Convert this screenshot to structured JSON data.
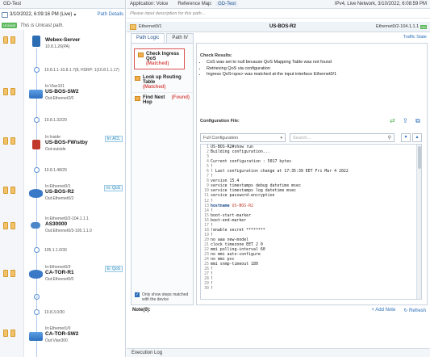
{
  "left_panel": {
    "title": "GD-Test",
    "datetime": "3/10/2022, 6:09:16 PM (Live)",
    "path_details": "Path Details",
    "unicast_badge": "Unicast",
    "unicast_note": "This is Unicast path.",
    "nodes": [
      {
        "top": "Webex-Server",
        "sub": "10.8.1.26(PA)",
        "icon": "server-icon",
        "tag": ""
      },
      {
        "top": "In:Vlan101",
        "name": "US-BOS-SW2",
        "out": "Out:Ethernet2/0",
        "icon": "switch-icon",
        "tag": ""
      },
      {
        "top": "In:Inside",
        "name": "US-BOS-FW\\stby",
        "out": "Out:outside",
        "icon": "firewall-icon",
        "tag": "In: ACL"
      },
      {
        "top": "In:Ethernet0/1",
        "name": "US-BOS-R2",
        "out": "Out:Ethernet0/2",
        "icon": "router-icon",
        "tag": "In: QoS"
      },
      {
        "top": "In:Ethernet0/2-104.1.1.1",
        "name": "AS30000",
        "out": "Out:Ethernet0/3-105.1.1.0",
        "icon": "cloud-icon",
        "tag": ""
      },
      {
        "top": "In:Ethernet0/3",
        "name": "CA-TOR-R1",
        "out": "Out:Ethernet0/0",
        "icon": "router-icon",
        "tag": "E: QoS"
      },
      {
        "top": "In:Ethernet1/0",
        "name": "CA-TOR-SW2",
        "out": "Out:Vlan300",
        "icon": "switch-icon",
        "tag": ""
      }
    ],
    "subnets": [
      "10.8.1.1-10.8.1.7(8, HSRP: 1(10.8.1.1.17)",
      "10.8.1.32/29",
      "10.8.1.48/29",
      "105.1.1.0/30",
      "10.8.3.0/30"
    ],
    "link_marker": "2"
  },
  "topbar": {
    "application_label": "Application: Voice",
    "reference_map_label": "Reference Map:",
    "map_name": "GD-Test",
    "right_info": "IPv4, Live Network, 3/10/2022, 6:08:59 PM"
  },
  "description_placeholder": "Please input description for this path...",
  "pathrow": {
    "in_interface": "Ethernet0/1",
    "device": "US-BOS-R2",
    "right_info": "Ethernet0/2-104.1.1.1",
    "ok_badge": "OK"
  },
  "tabs": [
    {
      "label": "Path Logic",
      "active": true
    },
    {
      "label": "Path IV",
      "active": false
    }
  ],
  "traffic_state": "Traffic State",
  "steps": [
    {
      "name": "Check Ingress QoS",
      "status": "(Matched)",
      "selected": true
    },
    {
      "name": "Look up Routing Table",
      "status": "(Matched)",
      "selected": false
    },
    {
      "name": "Find Next Hop",
      "status": "(Found)",
      "selected": false
    }
  ],
  "only_show": "Only show steps matched with the device",
  "check_results": {
    "title": "Check Results:",
    "items": [
      "CoS was set to null because QoS Mapping Table was not found",
      "Retrieving QoS via configuration",
      "Ingress QoS<qos> was matched at the input interface Ethernet0/1"
    ]
  },
  "config": {
    "title": "Configuration File:",
    "select_value": "Full Configuration",
    "search_placeholder": "Search...",
    "lines": [
      "US-BOS-R2#show run",
      "Building configuration...",
      "",
      "Current configuration : 5017 bytes",
      "!",
      "! Last configuration change at 17:35:39 EET Fri Mar 4 2022",
      "!",
      "version 15.4",
      "service timestamps debug datetime msec",
      "service timestamps log datetime msec",
      "service password-encryption",
      "!",
      "hostname US-BOS-R2",
      "!",
      "boot-start-marker",
      "boot-end-marker",
      "!",
      "!enable secret ********",
      "!",
      "no aaa new-model",
      "clock timezone EET 2 0",
      "mmi polling-interval 60",
      "no mmi auto-configure",
      "no mmi pvc",
      "mmi snmp-timeout 180",
      "!",
      "!",
      "!",
      "!",
      "!"
    ]
  },
  "note": {
    "label": "Note(0):",
    "add": "+ Add Note",
    "refresh": "Refresh"
  },
  "execution_log": "Execution Log"
}
